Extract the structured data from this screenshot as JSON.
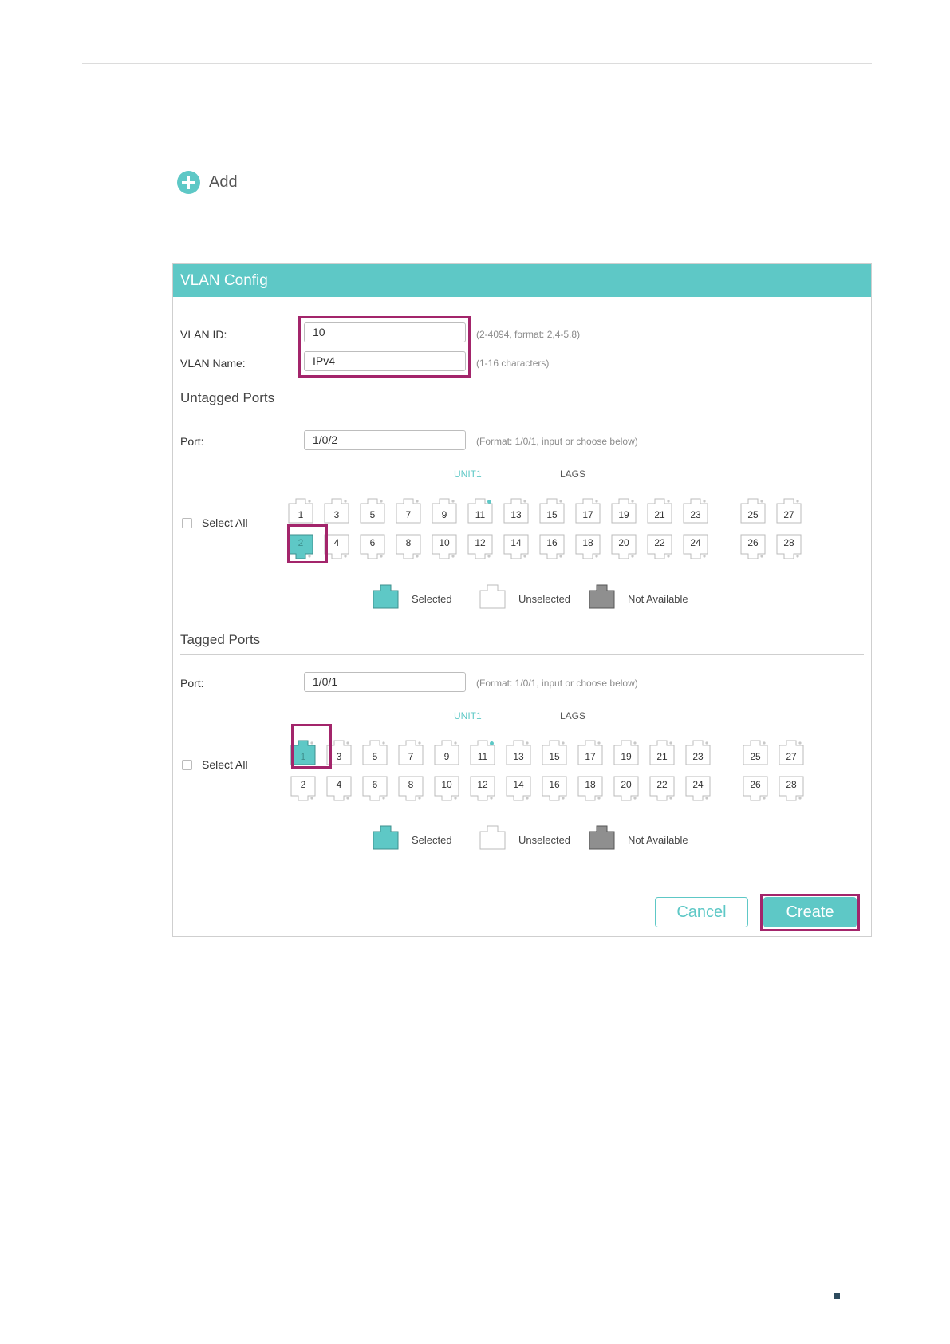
{
  "add": {
    "label": "Add"
  },
  "panel": {
    "title": "VLAN Config",
    "vlan_id": {
      "label": "VLAN ID:",
      "value": "10",
      "hint": "(2-4094, format: 2,4-5,8)"
    },
    "vlan_name": {
      "label": "VLAN Name:",
      "value": "IPv4",
      "hint": "(1-16 characters)"
    },
    "untagged": {
      "title": "Untagged Ports",
      "port_label": "Port:",
      "port_value": "1/0/2",
      "port_hint": "(Format: 1/0/1, input or choose below)",
      "unit_label": "UNIT1",
      "lags_label": "LAGS",
      "select_all": "Select All",
      "selected_ports": [
        2
      ]
    },
    "tagged": {
      "title": "Tagged Ports",
      "port_label": "Port:",
      "port_value": "1/0/1",
      "port_hint": "(Format: 1/0/1, input or choose below)",
      "unit_label": "UNIT1",
      "lags_label": "LAGS",
      "select_all": "Select All",
      "selected_ports": [
        1
      ]
    },
    "ports": {
      "top_row": [
        1,
        3,
        5,
        7,
        9,
        11,
        13,
        15,
        17,
        19,
        21,
        23,
        25,
        27
      ],
      "bottom_row": [
        2,
        4,
        6,
        8,
        10,
        12,
        14,
        16,
        18,
        20,
        22,
        24,
        26,
        28
      ],
      "active_port": 11
    },
    "legend": {
      "selected": "Selected",
      "unselected": "Unselected",
      "not_available": "Not Available"
    },
    "buttons": {
      "cancel": "Cancel",
      "create": "Create"
    }
  },
  "colors": {
    "accent": "#5ec8c6",
    "highlight": "#a3256b",
    "not_available": "#8f8f8f"
  }
}
